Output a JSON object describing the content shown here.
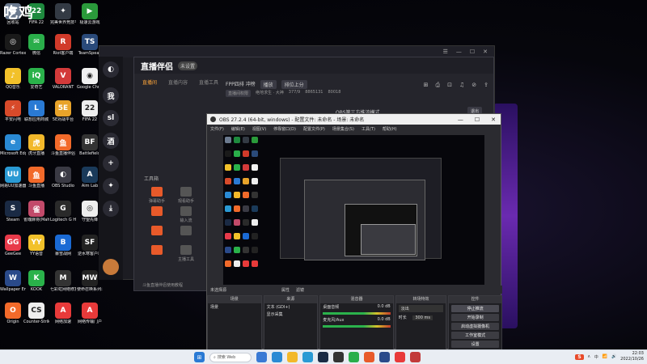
{
  "watermark": "吃鸡",
  "desktop_icons": [
    {
      "label": "回收站",
      "color": "#6b7a8f",
      "glyph": "🗑"
    },
    {
      "label": "FIFA 22",
      "color": "#1e8a3e",
      "glyph": "22"
    },
    {
      "label": "完美世界竞技平台",
      "color": "#333a44",
      "glyph": "✦"
    },
    {
      "label": "极速云游戏",
      "color": "#2a9a3a",
      "glyph": "▶"
    },
    {
      "label": "Razer Cortex",
      "color": "#1a1a1a",
      "glyph": "◎"
    },
    {
      "label": "微信",
      "color": "#2aae4a",
      "glyph": "✉"
    },
    {
      "label": "Riot客户端",
      "color": "#d13a2a",
      "glyph": "R"
    },
    {
      "label": "TeamSpeak",
      "color": "#2a4a7a",
      "glyph": "TS"
    },
    {
      "label": "QQ音乐",
      "color": "#f2c12a",
      "glyph": "♪"
    },
    {
      "label": "爱奇艺",
      "color": "#2ab24a",
      "glyph": "iQ"
    },
    {
      "label": "VALORANT",
      "color": "#d33a3a",
      "glyph": "V"
    },
    {
      "label": "Google Chrome",
      "color": "#f1f1f1",
      "glyph": "◉"
    },
    {
      "label": "平安闪电",
      "color": "#d84a2a",
      "glyph": "⚡"
    },
    {
      "label": "联想应用商城",
      "color": "#2a7ad4",
      "glyph": "L"
    },
    {
      "label": "5E对战平台",
      "color": "#e8a32a",
      "glyph": "5E"
    },
    {
      "label": "FIFA 22",
      "color": "#eeeeee",
      "glyph": "22"
    },
    {
      "label": "Microsoft Edge",
      "color": "#2a8ad4",
      "glyph": "e"
    },
    {
      "label": "虎牙直播",
      "color": "#f2b82a",
      "glyph": "虎"
    },
    {
      "label": "斗鱼直播伴侣",
      "color": "#f26a2a",
      "glyph": "鱼"
    },
    {
      "label": "Battlefield",
      "color": "#333333",
      "glyph": "BF"
    },
    {
      "label": "网易UU加速器",
      "color": "#2a9ad4",
      "glyph": "UU"
    },
    {
      "label": "斗鱼直播",
      "color": "#f26a2a",
      "glyph": "鱼"
    },
    {
      "label": "OBS Studio",
      "color": "#3a3a44",
      "glyph": "◐"
    },
    {
      "label": "Aim Lab",
      "color": "#1a3a5a",
      "glyph": "A"
    },
    {
      "label": "Steam",
      "color": "#1a2a44",
      "glyph": "S"
    },
    {
      "label": "雀魂麻将(Mahjong...",
      "color": "#c24a6a",
      "glyph": "雀"
    },
    {
      "label": "Logitech G HUB",
      "color": "#2a2a2a",
      "glyph": "G"
    },
    {
      "label": "守望先锋",
      "color": "#eeeeee",
      "glyph": "◎"
    },
    {
      "label": "GeeGee",
      "color": "#e83a4a",
      "glyph": "GG"
    },
    {
      "label": "YY语音",
      "color": "#f2c12a",
      "glyph": "YY"
    },
    {
      "label": "暴雪战网",
      "color": "#1a6ad4",
      "glyph": "B"
    },
    {
      "label": "逆水寒客户端",
      "color": "#222222",
      "glyph": "SF"
    },
    {
      "label": "Wallpaper Engine:...",
      "color": "#2a4a8a",
      "glyph": "W"
    },
    {
      "label": "KOOK",
      "color": "#2ab24a",
      "glyph": "K"
    },
    {
      "label": "七彩虹网络修复工具",
      "color": "#333333",
      "glyph": "M"
    },
    {
      "label": "使命召唤系列:现代战争",
      "color": "#222222",
      "glyph": "MW"
    },
    {
      "label": "Origin",
      "color": "#f26a2a",
      "glyph": "O"
    },
    {
      "label": "Counter-Strike: Global Off...",
      "color": "#eeeeee",
      "glyph": "CS"
    },
    {
      "label": "网络加速",
      "color": "#e83a3a",
      "glyph": "A"
    },
    {
      "label": "网络传输门户",
      "color": "#e83a3a",
      "glyph": "A"
    }
  ],
  "app_back": {
    "title_icons": [
      "☰",
      "—",
      "☐",
      "✕"
    ]
  },
  "app_side_buttons": [
    "◐",
    "我",
    "sl",
    "酒",
    "+",
    "✦",
    "⤓"
  ],
  "app": {
    "brand": "直播伴侣",
    "live_badge": "未设置",
    "tabs": [
      "直播间",
      "直播内容",
      "直播工具"
    ],
    "info_title": "FPP四排 冲榜",
    "info_pill1": "播放",
    "info_pill2": "排位上分",
    "sub_pill": "直播间权限",
    "sub_text1": "绝地求生 · 大神",
    "sub_text2": "377/9",
    "sub_text3": "8865131",
    "sub_text4": "80018",
    "right_icons": [
      "⊞",
      "⎙",
      "⊡",
      "♫",
      "⊘",
      "⇪"
    ],
    "obs_note": "OBS第三方推流模式",
    "right_btn": "退出",
    "tools_title": "工具箱",
    "tools": [
      "弹幕助手",
      "观看助手",
      "",
      "",
      "",
      "",
      "输入流",
      "",
      "",
      "",
      "",
      "",
      "",
      "",
      "",
      "",
      "主播工具",
      "",
      "",
      ""
    ],
    "footer": "斗鱼直播伴侣使用教程"
  },
  "obs": {
    "title": "OBS 27.2.4 (64-bit, windows) - 配置文件: 未命名 - 场景: 未命名",
    "win_buttons": [
      "—",
      "☐",
      "✕"
    ],
    "menu": [
      "文件(F)",
      "编辑(E)",
      "视图(V)",
      "停靠窗口(D)",
      "配置文件(P)",
      "场景集合(S)",
      "工具(T)",
      "帮助(H)"
    ],
    "dock_header": {
      "label": "未选择源",
      "btn1": "属性",
      "btn2": "滤镜"
    },
    "scenes": {
      "title": "场景",
      "items": [
        "场景"
      ]
    },
    "sources": {
      "title": "来源",
      "items": [
        "文本 (GDI+)",
        "显示采集"
      ]
    },
    "mixer": {
      "title": "混音器",
      "channels": [
        {
          "name": "桌面音频",
          "level": "0.0 dB"
        },
        {
          "name": "麦克风/Aux",
          "level": "0.0 dB"
        }
      ]
    },
    "transitions": {
      "title": "转场特效",
      "type": "淡出",
      "duration_label": "时长",
      "duration": "300 ms"
    },
    "controls": {
      "title": "控件",
      "buttons": [
        "停止推流",
        "开始录制",
        "启动虚拟摄像机",
        "工作室模式",
        "设置",
        "退出"
      ]
    }
  },
  "taskbar": {
    "search_label": "搜索 Web",
    "time": "22:03",
    "date": "2022/10/26",
    "tray_badge": "S",
    "tray_icons": [
      "ʌ",
      "中",
      "📶",
      "🔊"
    ]
  }
}
